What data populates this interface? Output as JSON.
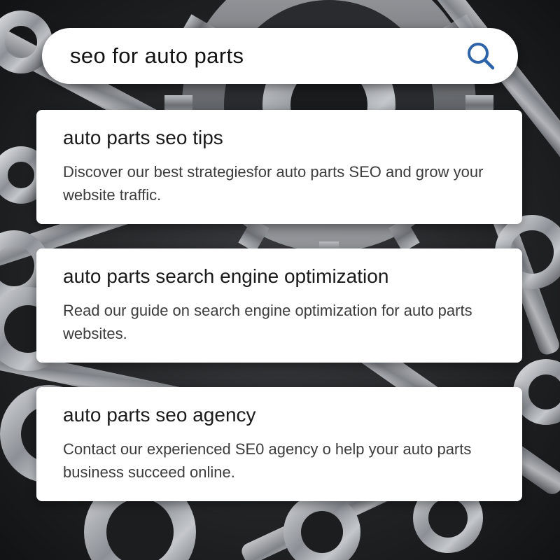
{
  "search": {
    "query": "seo for auto parts",
    "icon": "search-icon",
    "accent_color": "#2d63a8"
  },
  "results": [
    {
      "title": "auto parts seo tips",
      "description": "Discover our best strategiesfor auto parts SEO and grow your website traffic."
    },
    {
      "title": "auto parts search engine optimization",
      "description": "Read our guide on search engine optimization for auto parts websites."
    },
    {
      "title": "auto parts seo agency",
      "description": "Contact our experienced SE0 agency o help your auto parts business succeed online."
    }
  ],
  "colors": {
    "background": "#1e1f21",
    "card": "#ffffff",
    "title_text": "#1a1a1a",
    "description_text": "#3c3c3c"
  }
}
